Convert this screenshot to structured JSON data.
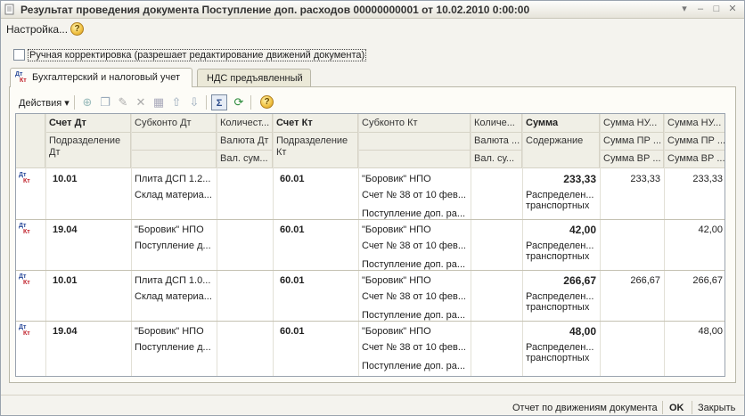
{
  "window": {
    "title": "Результат проведения документа Поступление доп. расходов 00000000001 от 10.02.2010 0:00:00"
  },
  "menubar": {
    "settings_label": "Настройка...",
    "help": "?"
  },
  "manual_correction": {
    "label": "Ручная корректировка (разрешает редактирование движений документа)",
    "checked": false
  },
  "tabs": [
    {
      "label": "Бухгалтерский и налоговый учет",
      "active": true
    },
    {
      "label": "НДС предъявленный",
      "active": false
    }
  ],
  "toolbar": {
    "actions_label": "Действия",
    "help": "?"
  },
  "icons": {
    "row_icon_dt": "Дт",
    "row_icon_kt": "Кт"
  },
  "table": {
    "header_row1": [
      "Счет Дт",
      "Субконто Дт",
      "Количест...",
      "Счет Кт",
      "Субконто Кт",
      "Количе...",
      "Сумма",
      "Сумма НУ...",
      "Сумма НУ..."
    ],
    "header_row2": [
      "Подразделение Дт",
      "",
      "Валюта Дт",
      "Подразделение Кт",
      "",
      "Валюта ...",
      "Содержание",
      "Сумма ПР ...",
      "Сумма ПР ..."
    ],
    "header_row3": [
      "",
      "",
      "Вал. сум...",
      "",
      "",
      "Вал. су...",
      "",
      "Сумма ВР ...",
      "Сумма ВР ..."
    ],
    "rows": [
      {
        "schet_dt": "10.01",
        "subkonto_dt": [
          "Плита ДСП 1.2...",
          "Склад материа..."
        ],
        "schet_kt": "60.01",
        "subkonto_kt": [
          "\"Боровик\" НПО",
          "Счет № 38 от 10 фев...",
          "Поступление доп. ра..."
        ],
        "summa": "233,33",
        "soderzhanie": "Распределен... транспортных",
        "summa_nu_dt": "233,33",
        "summa_nu_kt": "233,33"
      },
      {
        "schet_dt": "19.04",
        "subkonto_dt": [
          "\"Боровик\" НПО",
          "Поступление д..."
        ],
        "schet_kt": "60.01",
        "subkonto_kt": [
          "\"Боровик\" НПО",
          "Счет № 38 от 10 фев...",
          "Поступление доп. ра..."
        ],
        "summa": "42,00",
        "soderzhanie": "Распределен... транспортных",
        "summa_nu_dt": "",
        "summa_nu_kt": "42,00"
      },
      {
        "schet_dt": "10.01",
        "subkonto_dt": [
          "Плита ДСП 1.0...",
          "Склад материа..."
        ],
        "schet_kt": "60.01",
        "subkonto_kt": [
          "\"Боровик\" НПО",
          "Счет № 38 от 10 фев...",
          "Поступление доп. ра..."
        ],
        "summa": "266,67",
        "soderzhanie": "Распределен... транспортных",
        "summa_nu_dt": "266,67",
        "summa_nu_kt": "266,67"
      },
      {
        "schet_dt": "19.04",
        "subkonto_dt": [
          "\"Боровик\" НПО",
          "Поступление д..."
        ],
        "schet_kt": "60.01",
        "subkonto_kt": [
          "\"Боровик\" НПО",
          "Счет № 38 от 10 фев...",
          "Поступление доп. ра..."
        ],
        "summa": "48,00",
        "soderzhanie": "Распределен... транспортных",
        "summa_nu_dt": "",
        "summa_nu_kt": "48,00"
      }
    ]
  },
  "statusbar": {
    "report_label": "Отчет по движениям документа",
    "ok_label": "OK",
    "close_label": "Закрыть"
  }
}
